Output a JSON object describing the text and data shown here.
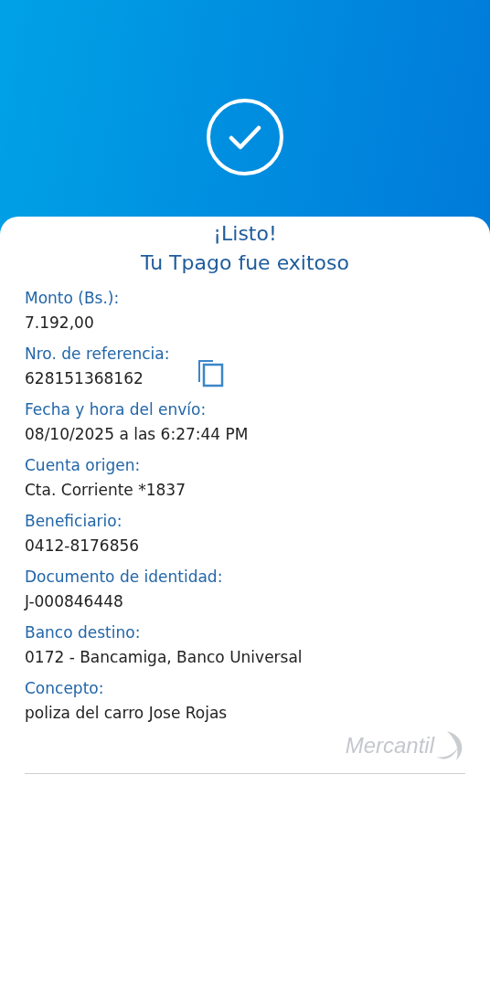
{
  "header": {
    "title": "¡Listo!",
    "subtitle": "Tu Tpago fue exitoso"
  },
  "fields": [
    {
      "label": "Monto (Bs.):",
      "value": "7.192,00",
      "copyable": false
    },
    {
      "label": "Nro. de referencia:",
      "value": "628151368162",
      "copyable": true
    },
    {
      "label": "Fecha y hora del envío:",
      "value": "08/10/2025 a las 6:27:44 PM",
      "copyable": false
    },
    {
      "label": "Cuenta origen:",
      "value": "Cta. Corriente *1837",
      "copyable": false
    },
    {
      "label": "Beneficiario:",
      "value": "0412-8176856",
      "copyable": false
    },
    {
      "label": "Documento de identidad:",
      "value": "J-000846448",
      "copyable": false
    },
    {
      "label": "Banco destino:",
      "value": "0172 - Bancamiga, Banco Universal",
      "copyable": false
    },
    {
      "label": "Concepto:",
      "value": "poliza del carro Jose Rojas",
      "copyable": false
    }
  ],
  "brand": {
    "name": "Mercantil"
  }
}
